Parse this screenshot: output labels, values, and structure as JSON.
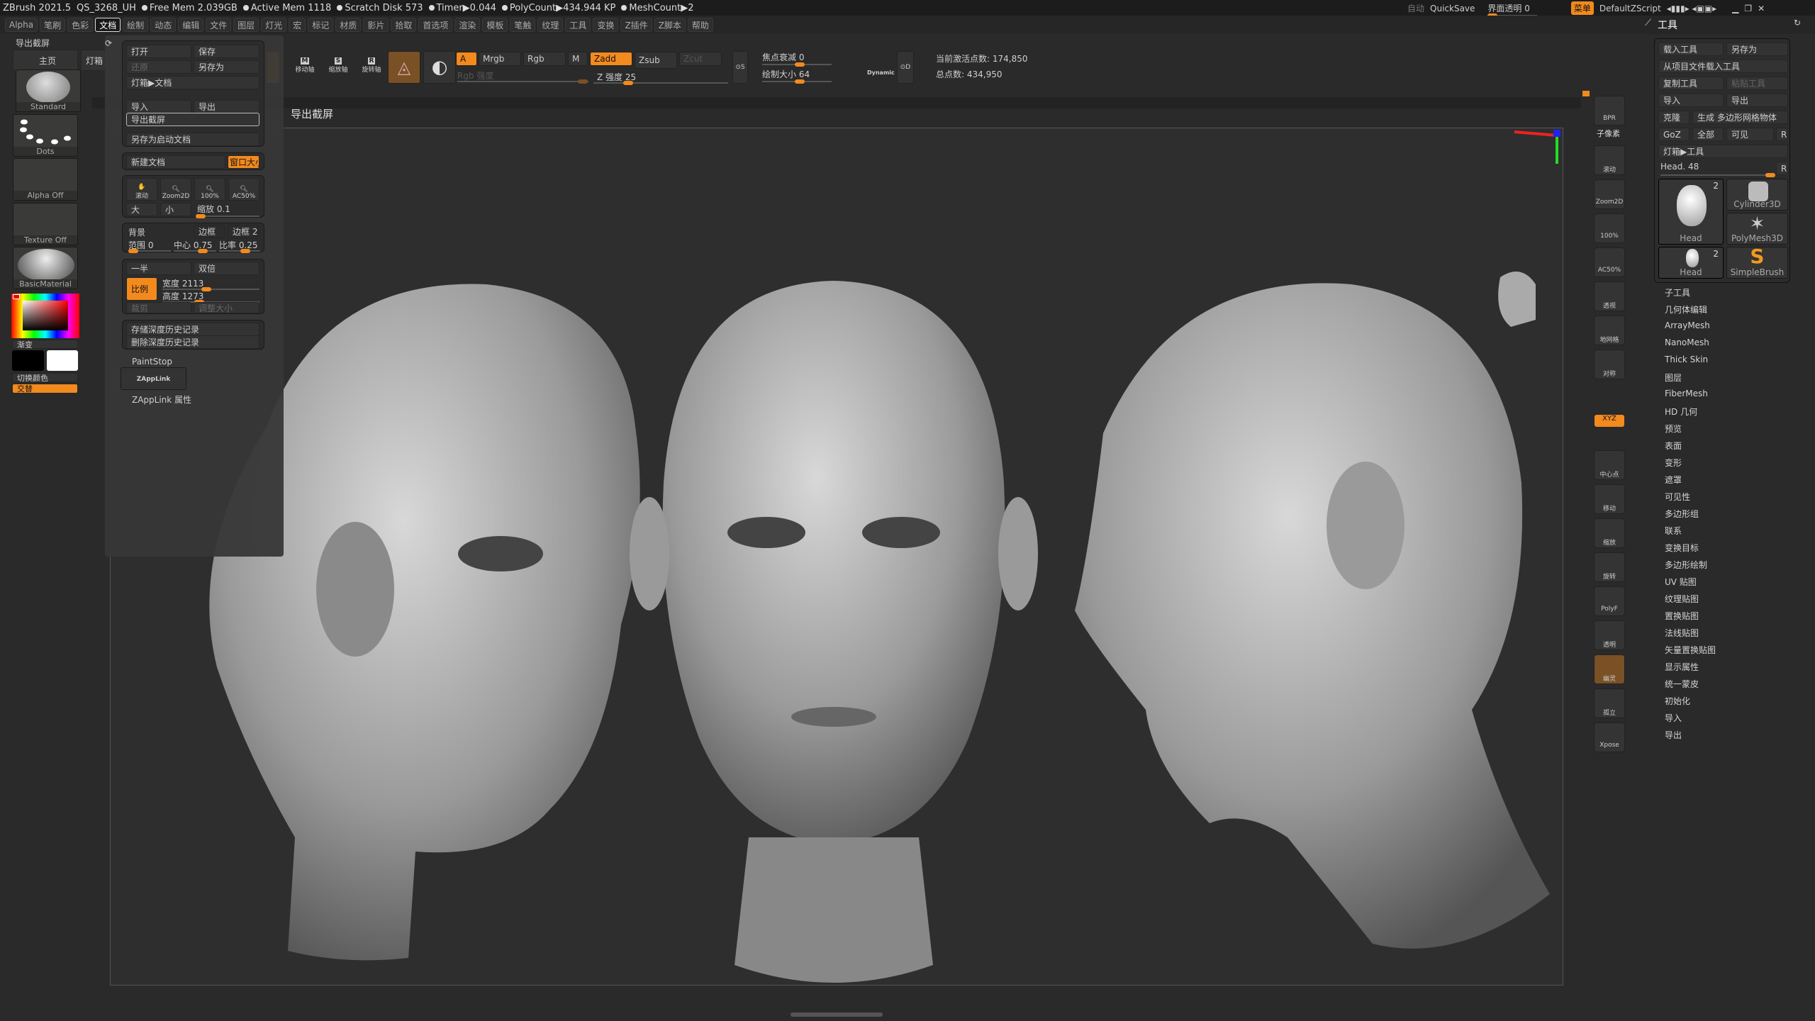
{
  "titlebar": {
    "app": "ZBrush 2021.5",
    "project": "QS_3268_UH",
    "free_mem": "Free Mem 2.039GB",
    "active_mem": "Active Mem 1118",
    "scratch": "Scratch Disk 573",
    "timer": "Timer▶0.044",
    "polycount": "PolyCount▶434.944 KP",
    "meshcount": "MeshCount▶2",
    "auto": "自动",
    "quicksave": "QuickSave",
    "ui_opacity": "界面透明 0",
    "menu_btn": "菜单",
    "script": "DefaultZScript"
  },
  "menus": [
    "Alpha",
    "笔刷",
    "色彩",
    "文档",
    "绘制",
    "动态",
    "编辑",
    "文件",
    "图层",
    "灯光",
    "宏",
    "标记",
    "材质",
    "影片",
    "拾取",
    "首选项",
    "渲染",
    "模板",
    "笔触",
    "纹理",
    "工具",
    "变换",
    "Z插件",
    "Z脚本",
    "帮助"
  ],
  "active_menu": "文档",
  "left": {
    "tray_title": "导出截屏",
    "home": "主页",
    "lightbox": "灯箱",
    "brush": "Standard",
    "stroke": "Dots",
    "alpha": "Alpha Off",
    "texture": "Texture Off",
    "material": "BasicMaterial",
    "gradient": "渐变",
    "switch_color": "切换颜色",
    "alternate": "交替"
  },
  "docmenu": {
    "open": "打开",
    "save": "保存",
    "revert": "还原",
    "save_as": "另存为",
    "lightbox_doc": "灯箱▶文档",
    "import": "导入",
    "export": "导出",
    "export_screen": "导出截屏",
    "save_startup": "另存为启动文档",
    "new_doc": "新建文档",
    "window_size": "窗口大小",
    "scroll": "滚动",
    "zoom2d": "Zoom2D",
    "z100": "100%",
    "ac50": "AC50%",
    "large": "大",
    "small": "小",
    "zoom": "缩放 0.1",
    "bg": "背景",
    "border": "边框",
    "border2": "边框 2",
    "range": "范围 0",
    "center": "中心 0.75",
    "rate": "比率 0.25",
    "half": "一半",
    "double": "双倍",
    "ratio": "比例",
    "width": "宽度 2113",
    "height": "高度 1273",
    "crop": "裁剪",
    "resize": "调整大小",
    "store_depth": "存储深度历史记录",
    "delete_depth": "删除深度历史记录",
    "paintstop": "PaintStop",
    "zapplink": "ZAppLink",
    "zapplink_props": "ZAppLink 属性"
  },
  "toolbar": {
    "move": "移动轴",
    "scale": "缩放轴",
    "rotate": "旋转轴",
    "a": "A",
    "mrgb": "Mrgb",
    "rgb": "Rgb",
    "m": "M",
    "zadd": "Zadd",
    "zsub": "Zsub",
    "zcut": "Zcut",
    "rgb_intensity": "Rgb 强度",
    "z_intensity": "Z 强度 25",
    "focal": "焦点衰减 0",
    "draw_size": "绘制大小 64",
    "dynamic": "Dynamic",
    "active_points": "当前激活点数: 174,850",
    "total_points": "总点数: 434,950"
  },
  "canvas": {
    "title": "导出截屏"
  },
  "shelf": [
    "BPR",
    "子像素",
    "滚动",
    "Zoom2D",
    "100%",
    "AC50%",
    "透视",
    "地网格",
    "对称",
    "",
    "XYZ",
    "中心点",
    "移动",
    "缩放",
    "旋转",
    "PolyF",
    "透明",
    "幽灵",
    "孤立",
    "Xpose"
  ],
  "right": {
    "title": "工具",
    "load": "载入工具",
    "save_as": "另存为",
    "load_project": "从项目文件载入工具",
    "copy": "复制工具",
    "paste": "粘贴工具",
    "import": "导入",
    "export": "导出",
    "clone": "克隆",
    "make_poly": "生成 多边形网格物体",
    "goz": "GoZ",
    "all": "全部",
    "visible": "可见",
    "r": "R",
    "lightbox": "灯箱▶工具",
    "head_slider": "Head. 48",
    "tools": [
      {
        "name": "Head",
        "count": "2"
      },
      {
        "name": "Cylinder3D"
      },
      {
        "name": "PolyMesh3D"
      },
      {
        "name": "Head",
        "count": "2"
      },
      {
        "name": "SimpleBrush"
      }
    ],
    "items": [
      "子工具",
      "几何体编辑",
      "ArrayMesh",
      "NanoMesh",
      "Thick Skin",
      "图层",
      "FiberMesh",
      "HD 几何",
      "预览",
      "表面",
      "变形",
      "遮罩",
      "可见性",
      "多边形组",
      "联系",
      "变换目标",
      "多边形绘制",
      "UV 贴图",
      "纹理贴图",
      "置换贴图",
      "法线贴图",
      "矢量置换贴图",
      "显示属性",
      "统一蒙皮",
      "初始化",
      "导入",
      "导出"
    ]
  },
  "colors": {
    "accent": "#f28a1e",
    "bg": "#2a2a2a"
  }
}
